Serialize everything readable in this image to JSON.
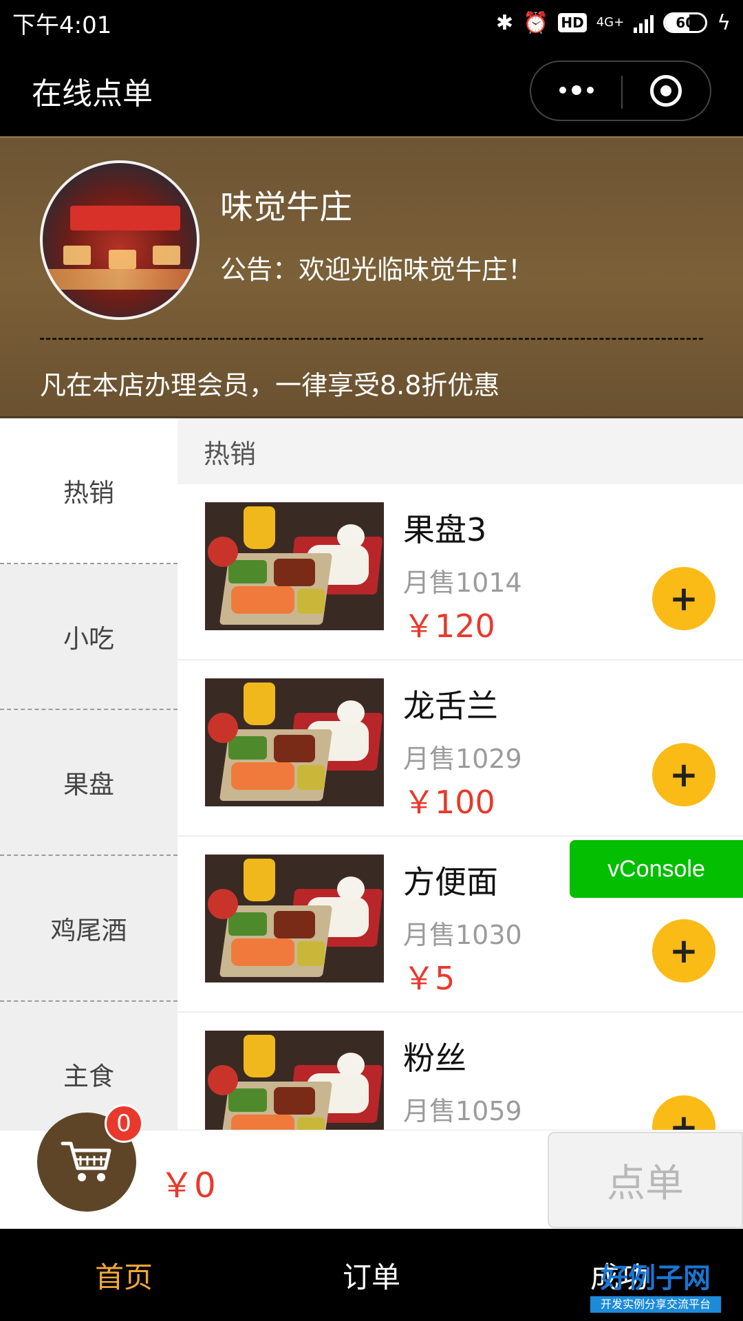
{
  "status_bar": {
    "time": "下午4:01",
    "icons": [
      "bluetooth-icon",
      "alarm-icon",
      "hd-icon",
      "signal-icon",
      "battery-icon",
      "charging-icon"
    ],
    "hd_label": "HD",
    "network": "4G+",
    "battery": "60"
  },
  "nav": {
    "title": "在线点单",
    "capsule_icons": [
      "more-icon",
      "target-icon"
    ]
  },
  "shop": {
    "name": "味觉牛庄",
    "notice": "公告：欢迎光临味觉牛庄！",
    "promo": "凡在本店办理会员，一律享受8.8折优惠"
  },
  "categories": [
    "热销",
    "小吃",
    "果盘",
    "鸡尾酒",
    "主食"
  ],
  "section": {
    "title": "热销"
  },
  "products": [
    {
      "name": "果盘3",
      "sales": "月售1014",
      "price": "￥120",
      "add": "+"
    },
    {
      "name": "龙舌兰",
      "sales": "月售1029",
      "price": "￥100",
      "add": "+"
    },
    {
      "name": "方便面",
      "sales": "月售1030",
      "price": "￥5",
      "add": "+"
    },
    {
      "name": "粉丝",
      "sales": "月售1059",
      "price": "",
      "add": "+"
    }
  ],
  "vconsole": {
    "label": "vConsole"
  },
  "cart": {
    "count": "0",
    "total": "￥0",
    "order_label": "点单"
  },
  "tabs": [
    {
      "label": "首页",
      "active": true
    },
    {
      "label": "订单",
      "active": false
    },
    {
      "label": "成功",
      "active": false
    }
  ],
  "colors": {
    "header_brown": "#7b6038",
    "price_red": "#e8392c",
    "add_yellow": "#fbbb16",
    "tab_active": "#f2a73a",
    "vconsole_green": "#04be02"
  }
}
